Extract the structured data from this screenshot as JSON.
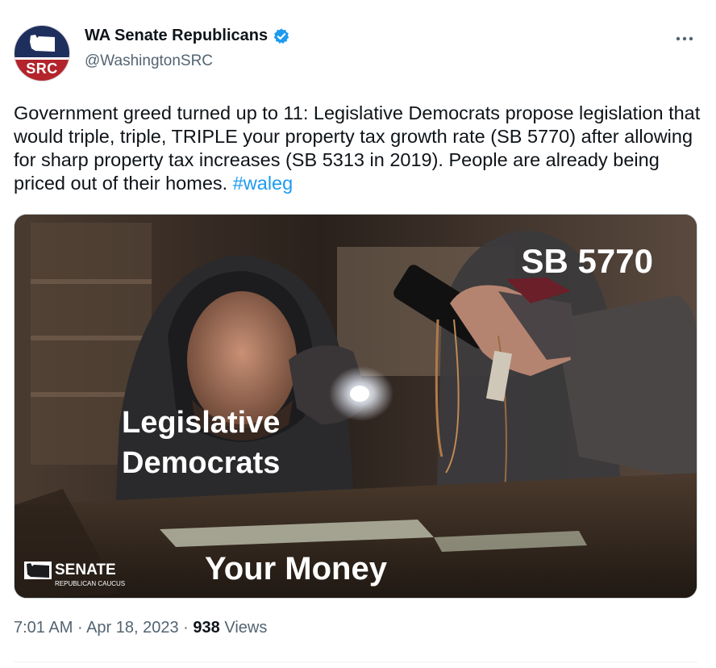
{
  "author": {
    "display_name": "WA Senate Republicans",
    "handle": "@WashingtonSRC",
    "avatar_text": "SRC",
    "verified_icon": "verified-badge-icon"
  },
  "tweet": {
    "text": "Government greed turned up to 11: Legislative Democrats propose legislation that would triple, triple, TRIPLE your property tax growth rate (SB 5770) after allowing for sharp property tax increases (SB 5313 in 2019). People are already being priced out of their homes. ",
    "hashtag": "#waleg"
  },
  "media": {
    "caption_bill": "SB 5770",
    "caption_line1": "Legislative",
    "caption_line2": "Democrats",
    "caption_money": "Your Money",
    "logo_title": "SENATE",
    "logo_subtitle": "REPUBLICAN CAUCUS"
  },
  "meta": {
    "time": "7:01 AM",
    "separator": "·",
    "date": "Apr 18, 2023",
    "views_count": "938",
    "views_label": "Views"
  },
  "colors": {
    "accent": "#1d9bf0",
    "text": "#0f1419",
    "secondary": "#536471"
  }
}
